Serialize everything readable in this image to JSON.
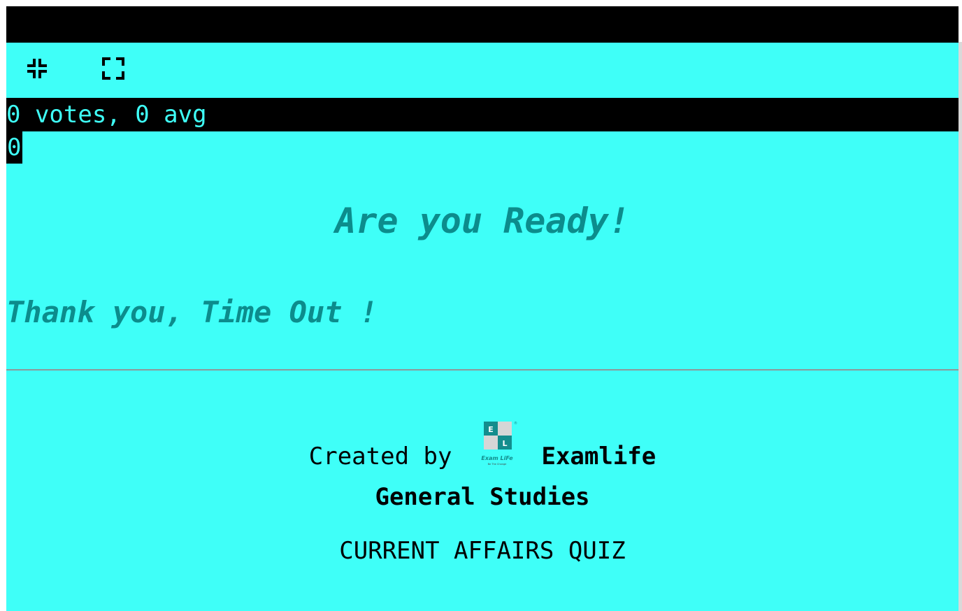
{
  "quiz": {
    "votes_text": "0 votes, 0 avg",
    "score": "0",
    "ready_heading": "Are you Ready!",
    "timeout_message": "Thank you, Time Out !",
    "created_by_prefix": "Created by",
    "creator_name": "Examlife",
    "subject": "General Studies",
    "quiz_title": "CURRENT AFFAIRS QUIZ"
  },
  "logo": {
    "letter_top": "E",
    "letter_bottom": "L",
    "brand_text": "Exam LiFe",
    "tagline": "Be The Change",
    "registered_mark": "®"
  },
  "icons": {
    "exit_fullscreen": "exit-fullscreen-icon",
    "fullscreen": "fullscreen-icon"
  },
  "colors": {
    "background": "#3ffff8",
    "bar": "#000000",
    "heading": "#0c8c8c",
    "logo_teal": "#138d8d",
    "logo_grey": "#d6d6d6"
  }
}
